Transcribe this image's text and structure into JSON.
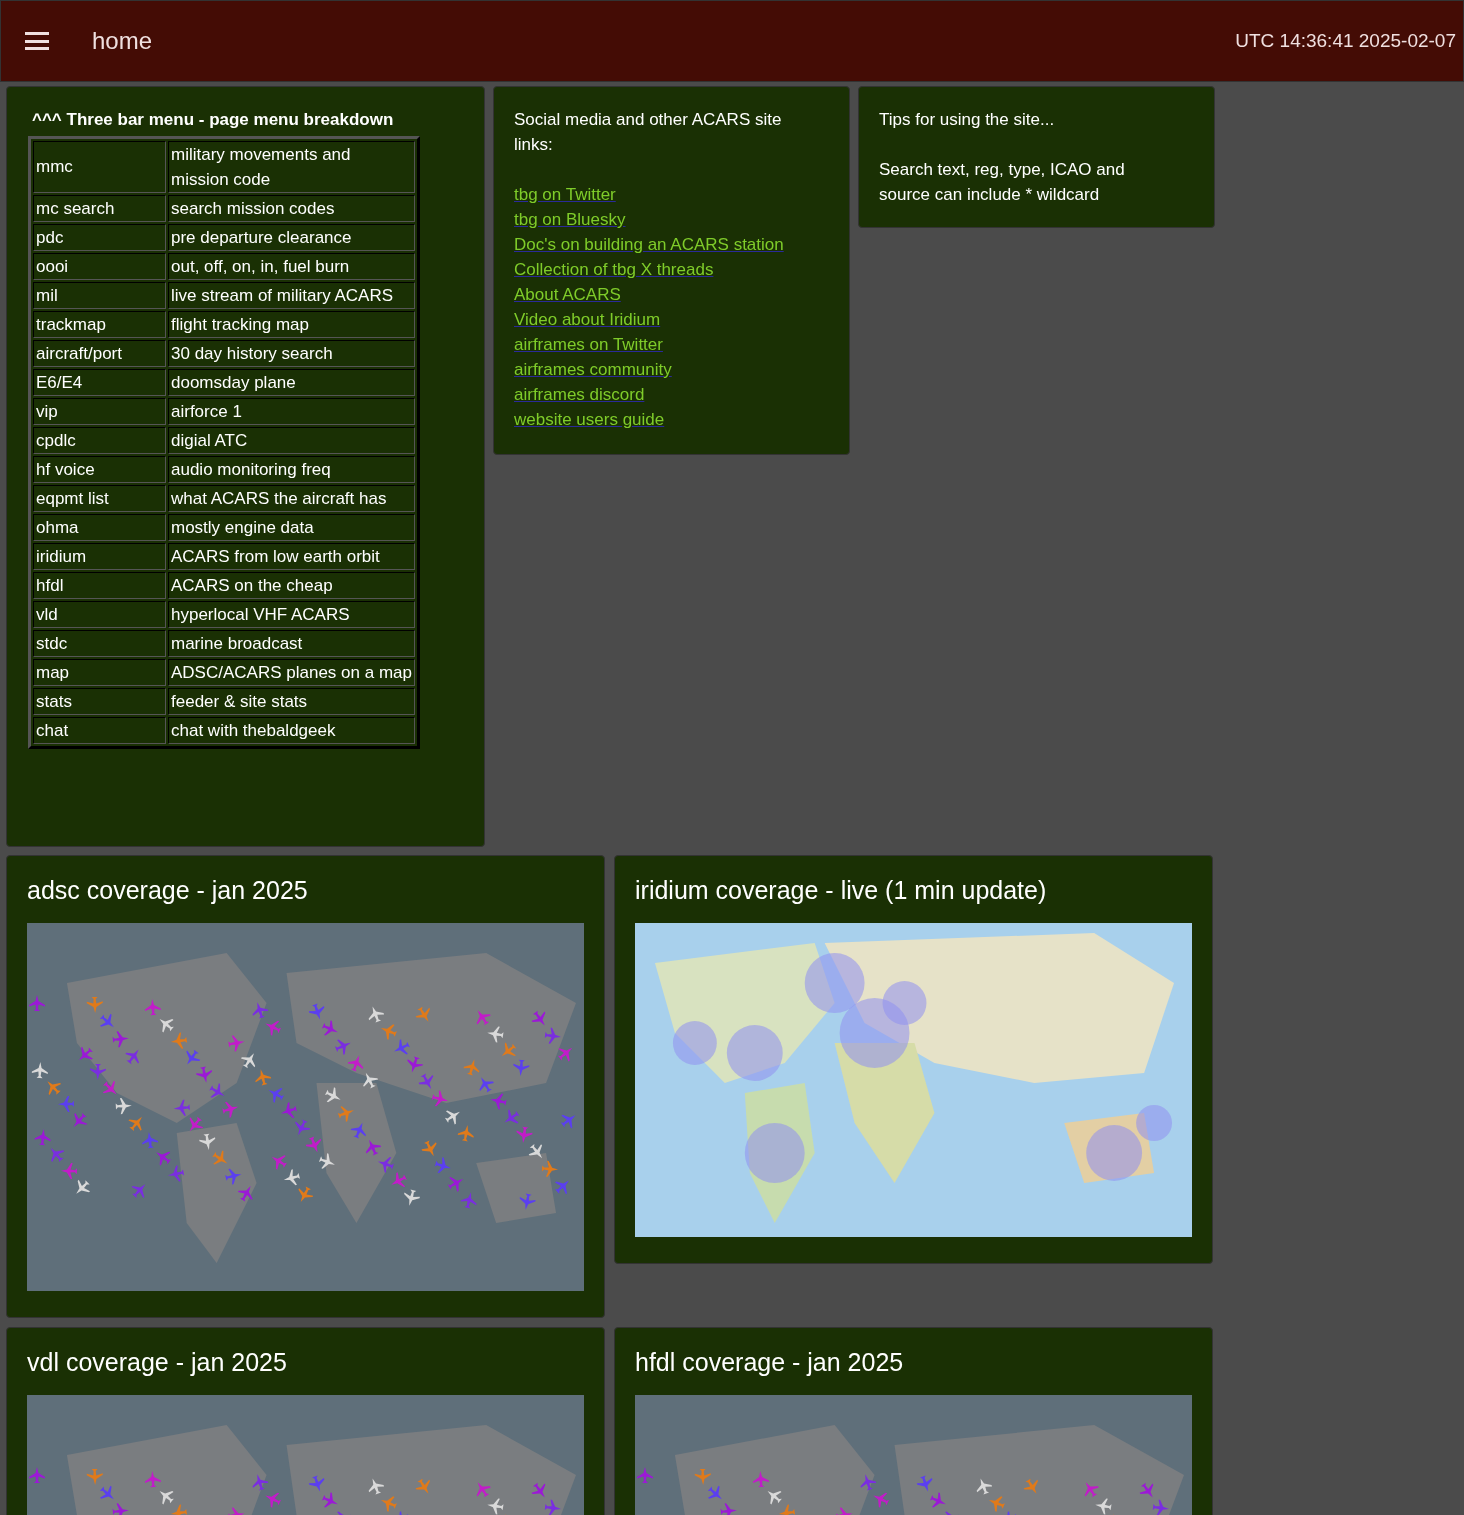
{
  "header": {
    "title": "home",
    "clock": "UTC 14:36:41 2025-02-07"
  },
  "menu_card": {
    "heading": "^^^ Three bar menu - page menu breakdown",
    "rows": [
      {
        "name": "mmc",
        "description": "military movements and mission code"
      },
      {
        "name": "mc search",
        "description": "search mission codes"
      },
      {
        "name": "pdc",
        "description": "pre departure clearance"
      },
      {
        "name": "oooi",
        "description": "out, off, on, in, fuel burn"
      },
      {
        "name": "mil",
        "description": "live stream of military ACARS"
      },
      {
        "name": "trackmap",
        "description": "flight tracking map"
      },
      {
        "name": "aircraft/port",
        "description": "30 day history search"
      },
      {
        "name": "E6/E4",
        "description": "doomsday plane"
      },
      {
        "name": "vip",
        "description": "airforce 1"
      },
      {
        "name": "cpdlc",
        "description": "digial ATC"
      },
      {
        "name": "hf voice",
        "description": "audio monitoring freq"
      },
      {
        "name": "eqpmt list",
        "description": "what ACARS the aircraft has"
      },
      {
        "name": "ohma",
        "description": "mostly engine data"
      },
      {
        "name": "iridium",
        "description": "ACARS from low earth orbit"
      },
      {
        "name": "hfdl",
        "description": "ACARS on the cheap"
      },
      {
        "name": "vld",
        "description": "hyperlocal VHF ACARS"
      },
      {
        "name": "stdc",
        "description": "marine broadcast"
      },
      {
        "name": "map",
        "description": "ADSC/ACARS planes on a map"
      },
      {
        "name": "stats",
        "description": "feeder & site stats"
      },
      {
        "name": "chat",
        "description": "chat with thebaldgeek"
      }
    ]
  },
  "links_card": {
    "heading": "Social media and other ACARS site links:",
    "links": [
      "tbg on Twitter",
      "tbg on Bluesky",
      "Doc's on building an ACARS station",
      "Collection of tbg X threads",
      "About ACARS",
      "Video about Iridium",
      "airframes on Twitter",
      "airframes community",
      "airframes discord",
      "website users guide"
    ]
  },
  "tips_card": {
    "heading": "Tips for using the site...",
    "tip": "Search text, reg, type, ICAO and source can include * wildcard"
  },
  "map_cards": [
    {
      "title": "adsc coverage - jan 2025",
      "kind": "planes"
    },
    {
      "title": "iridium coverage - live (1 min update)",
      "kind": "iridium"
    },
    {
      "title": "vdl coverage - jan 2025",
      "kind": "planes"
    },
    {
      "title": "hfdl coverage - jan 2025",
      "kind": "planes"
    }
  ]
}
